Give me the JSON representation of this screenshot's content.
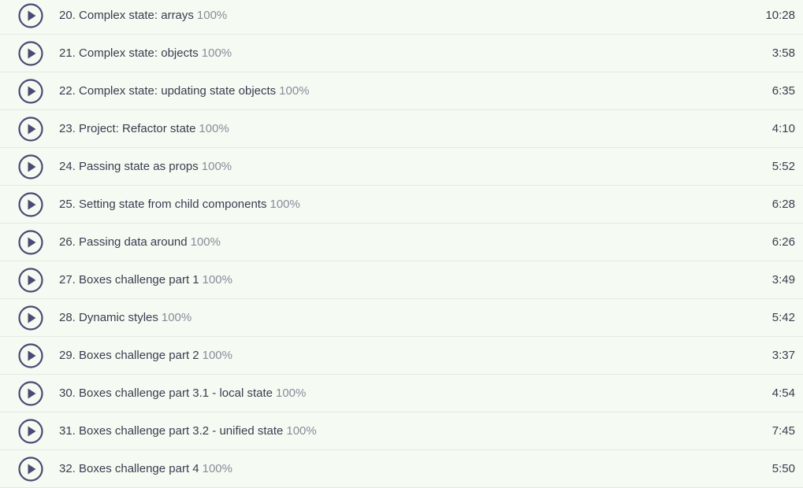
{
  "colors": {
    "background": "#f5fbf3",
    "play_icon": "#4b4a73",
    "title_text": "#3b3b4f",
    "progress_text": "#8a8a99",
    "divider": "#e3eae1"
  },
  "lessons": [
    {
      "icon": "play-circle-icon",
      "title": "20. Complex state: arrays",
      "progress": "100%",
      "duration": "10:28"
    },
    {
      "icon": "play-circle-icon",
      "title": "21. Complex state: objects",
      "progress": "100%",
      "duration": "3:58"
    },
    {
      "icon": "play-circle-icon",
      "title": "22. Complex state: updating state objects",
      "progress": "100%",
      "duration": "6:35"
    },
    {
      "icon": "play-circle-icon",
      "title": "23. Project: Refactor state",
      "progress": "100%",
      "duration": "4:10"
    },
    {
      "icon": "play-circle-icon",
      "title": "24. Passing state as props",
      "progress": "100%",
      "duration": "5:52"
    },
    {
      "icon": "play-circle-icon",
      "title": "25. Setting state from child components",
      "progress": "100%",
      "duration": "6:28"
    },
    {
      "icon": "play-circle-icon",
      "title": "26. Passing data around",
      "progress": "100%",
      "duration": "6:26"
    },
    {
      "icon": "play-circle-icon",
      "title": "27. Boxes challenge part 1",
      "progress": "100%",
      "duration": "3:49"
    },
    {
      "icon": "play-circle-icon",
      "title": "28. Dynamic styles",
      "progress": "100%",
      "duration": "5:42"
    },
    {
      "icon": "play-circle-icon",
      "title": "29. Boxes challenge part 2",
      "progress": "100%",
      "duration": "3:37"
    },
    {
      "icon": "play-circle-icon",
      "title": "30. Boxes challenge part 3.1 - local state",
      "progress": "100%",
      "duration": "4:54"
    },
    {
      "icon": "play-circle-icon",
      "title": "31. Boxes challenge part 3.2 - unified state",
      "progress": "100%",
      "duration": "7:45"
    },
    {
      "icon": "play-circle-icon",
      "title": "32. Boxes challenge part 4",
      "progress": "100%",
      "duration": "5:50"
    }
  ]
}
